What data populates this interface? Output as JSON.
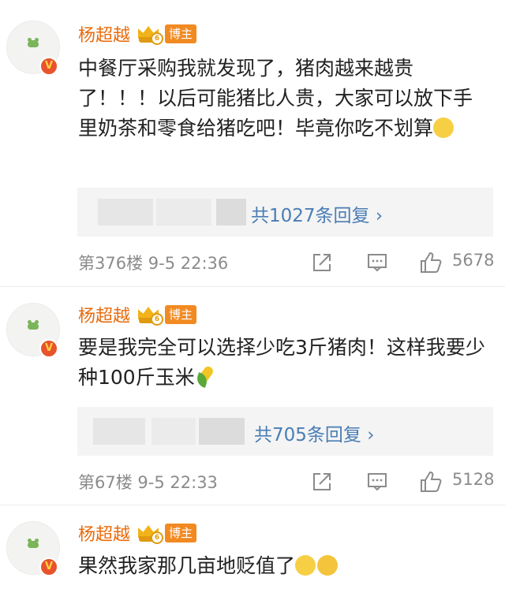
{
  "comments": [
    {
      "user": "杨超越",
      "blogger_badge": "博主",
      "verified_mark": "V",
      "text": "中餐厅采购我就发现了，猪肉越来越贵了！！！以后可能猪比人贵，大家可以放下手里奶茶和零食给猪吃吧！毕竟你吃不划算",
      "emoji_icons": [
        "thinking-face-emoji"
      ],
      "reply_link": "共1027条回复",
      "floor": "第376楼",
      "time": "9-5 22:36",
      "likes": "5678"
    },
    {
      "user": "杨超越",
      "blogger_badge": "博主",
      "verified_mark": "V",
      "text": "要是我完全可以选择少吃3斤猪肉！这样我要少种100斤玉米",
      "emoji_icons": [
        "corn-emoji"
      ],
      "reply_link": "共705条回复",
      "floor": "第67楼",
      "time": "9-5 22:33",
      "likes": "5128"
    },
    {
      "user": "杨超越",
      "blogger_badge": "博主",
      "verified_mark": "V",
      "text": "果然我家那几亩地贬值了",
      "emoji_icons": [
        "sad-face-emoji",
        "crying-face-emoji"
      ]
    }
  ],
  "reply_arrow": "›",
  "colors": {
    "username": "#e86b0c",
    "badge": "#f28a22",
    "link": "#4a7db5",
    "meta": "#8b8b8b"
  }
}
